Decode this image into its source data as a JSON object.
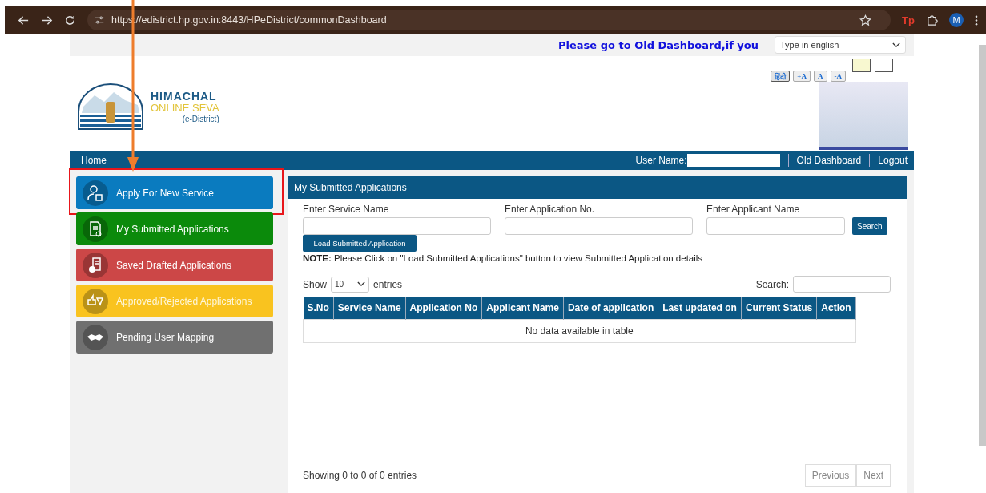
{
  "browser": {
    "url": "https://edistrict.hp.gov.in:8443/HPeDistrict/commonDashboard",
    "extension_badge": "Tp",
    "avatar": "M"
  },
  "top_strip": {
    "notice": "Please go to Old Dashboard,if you",
    "language_select": "Type in english"
  },
  "accessibility": {
    "buttons": [
      {
        "label": "हिंदी",
        "selected": true
      },
      {
        "label": "+A",
        "selected": false
      },
      {
        "label": "A",
        "selected": false
      },
      {
        "label": "-A",
        "selected": false
      }
    ],
    "themes": [
      {
        "color": "#f8f8d0"
      },
      {
        "color": "#ffffff"
      }
    ]
  },
  "brand": {
    "title": "HIMACHAL",
    "subtitle": "ONLINE SEVA",
    "tagline": "(e-District)"
  },
  "nav": {
    "home": "Home",
    "user_label": "User Name:",
    "links": [
      "Old Dashboard",
      "Logout"
    ]
  },
  "sidebar": {
    "items": [
      {
        "label": "Apply For New Service",
        "color": "#0a7bbf",
        "kind": "person",
        "highlighted": true
      },
      {
        "label": "My Submitted Applications",
        "color": "#0b8a0b",
        "kind": "document",
        "highlighted": false
      },
      {
        "label": "Saved Drafted Applications",
        "color": "#cc4747",
        "kind": "draft",
        "highlighted": false
      },
      {
        "label": "Approved/Rejected Applications",
        "color": "#f9c31f",
        "kind": "thumbs",
        "highlighted": false
      },
      {
        "label": "Pending User Mapping",
        "color": "#707070",
        "kind": "handshake",
        "highlighted": false
      }
    ]
  },
  "panel": {
    "title": "My Submitted Applications",
    "fields": [
      {
        "label": "Enter Service Name"
      },
      {
        "label": "Enter Application No."
      },
      {
        "label": "Enter Applicant Name"
      }
    ],
    "search_button": "Search",
    "load_button": "Load Submitted Application",
    "note": "**NOTE:** Please Click on \"Load Submitted Applications\" button to view Submitted Application details",
    "show_label": "Show",
    "page_size": "10",
    "entries_label": "entries",
    "search_label": "Search:",
    "table": {
      "columns": [
        "S.No",
        "Service Name",
        "Application No",
        "Applicant Name",
        "Date of application",
        "Last updated on",
        "Current Status",
        "Action"
      ],
      "empty_message": "No data available in table"
    },
    "info": "Showing 0 to 0 of 0 entries",
    "pager": [
      {
        "label": "Previous",
        "disabled": true
      },
      {
        "label": "Next",
        "disabled": true
      }
    ]
  }
}
